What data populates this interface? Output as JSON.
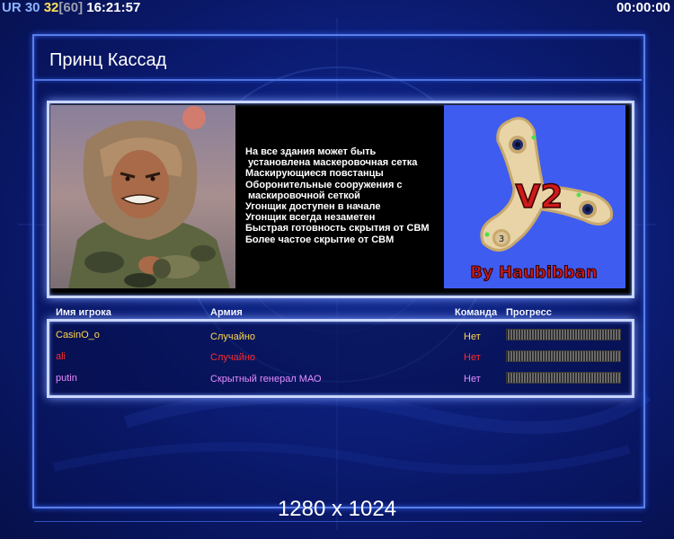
{
  "hud": {
    "left": {
      "ur": "UR",
      "fps": "30",
      "count": "32",
      "limit": "[60]",
      "clock": "16:21:57"
    },
    "right_timer": "00:00:00"
  },
  "title": "Принц Кассад",
  "features": [
    "На все здания может быть",
    " установлена маскеровочная сетка",
    "Маскирующиеся повстанцы",
    "Оборонительные сооружения с",
    " маскировочной сеткой",
    "Угонщик доступен в начале",
    "Угонщик всегда незаметен",
    "Быстрая готовность скрытия от СВМ",
    "Более частое скрытие от СВМ"
  ],
  "map_preview": {
    "label_main": "V2",
    "label_credit": "By Haubibban",
    "start_marker": "3"
  },
  "table": {
    "headers": {
      "player": "Имя игрока",
      "army": "Армия",
      "team": "Команда",
      "progress": "Прогресс"
    },
    "rows": [
      {
        "name": "CasinO_o",
        "army": "Случайно",
        "team": "Нет",
        "name_color": "#ffd84a",
        "army_color": "#ffd84a",
        "team_color": "#ffd84a"
      },
      {
        "name": "ali",
        "army": "Случайно",
        "team": "Нет",
        "name_color": "#ff2a2a",
        "army_color": "#ff2a2a",
        "team_color": "#ff2a2a"
      },
      {
        "name": "putin",
        "army": "Скрытный генерал МАО",
        "team": "Нет",
        "name_color": "#e58cff",
        "army_color": "#e58cff",
        "team_color": "#e58cff"
      }
    ]
  },
  "resolution": "1280 x 1024",
  "colors": {
    "frame": "#5a7fe8",
    "panel_border": "#c9d6ff",
    "background": "#0a1560"
  }
}
